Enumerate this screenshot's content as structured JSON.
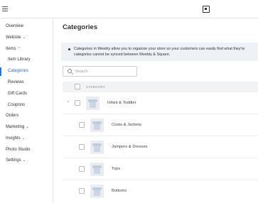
{
  "topbar": {
    "menu_icon": "hamburger-icon",
    "logo_icon": "square-logo-icon"
  },
  "sidebar": {
    "items": [
      {
        "label": "Overview"
      },
      {
        "label": "Website",
        "chevron": "⌄"
      },
      {
        "label": "Items",
        "chevron": "⌃"
      },
      {
        "label": "Item Library"
      },
      {
        "label": "Categories"
      },
      {
        "label": "Reviews"
      },
      {
        "label": "Gift Cards"
      },
      {
        "label": "Coupons"
      },
      {
        "label": "Orders"
      },
      {
        "label": "Marketing",
        "chevron": "⌄"
      },
      {
        "label": "Insights",
        "chevron": "⌄"
      },
      {
        "label": "Photo Studio"
      },
      {
        "label": "Settings",
        "chevron": "⌄"
      }
    ],
    "active_color": "#2e6fdb"
  },
  "main": {
    "title": "Categories",
    "notice": "Categories in Weebly allow you to organize your store so your customers can easily find what they're\ncategories cannot be synced between Weebly & Square.",
    "search": {
      "placeholder": "Search",
      "value": ""
    },
    "table": {
      "header": "CATEGORY",
      "rows": [
        {
          "name": "Infant & Toddler",
          "expand": "⌃"
        },
        {
          "name": "Coats & Jackets"
        },
        {
          "name": "Jumpers & Dresses"
        },
        {
          "name": "Tops"
        },
        {
          "name": "Bottoms"
        }
      ]
    }
  }
}
